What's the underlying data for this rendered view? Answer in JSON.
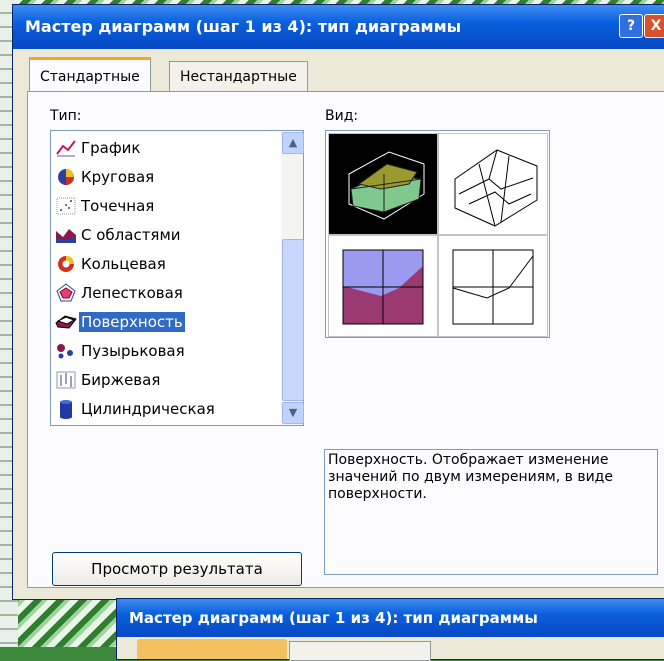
{
  "dialog": {
    "title": "Мастер диаграмм (шаг 1 из 4): тип диаграммы",
    "help_btn": "?",
    "close_btn": "X"
  },
  "tabs": [
    {
      "label": "Стандартные",
      "active": true
    },
    {
      "label": "Нестандартные",
      "active": false
    }
  ],
  "type_label": "Тип:",
  "view_label": "Вид:",
  "types": [
    {
      "label": "График",
      "icon": "line-chart-icon",
      "selected": false
    },
    {
      "label": "Круговая",
      "icon": "pie-chart-icon",
      "selected": false
    },
    {
      "label": "Точечная",
      "icon": "scatter-chart-icon",
      "selected": false
    },
    {
      "label": "С областями",
      "icon": "area-chart-icon",
      "selected": false
    },
    {
      "label": "Кольцевая",
      "icon": "doughnut-chart-icon",
      "selected": false
    },
    {
      "label": "Лепестковая",
      "icon": "radar-chart-icon",
      "selected": false
    },
    {
      "label": "Поверхность",
      "icon": "surface-chart-icon",
      "selected": true
    },
    {
      "label": "Пузырьковая",
      "icon": "bubble-chart-icon",
      "selected": false
    },
    {
      "label": "Биржевая",
      "icon": "stock-chart-icon",
      "selected": false
    },
    {
      "label": "Цилиндрическая",
      "icon": "cylinder-chart-icon",
      "selected": false
    }
  ],
  "description": "Поверхность. Отображает изменение значений по двум измерениям, в виде поверхности.",
  "preview_button": "Просмотр результата",
  "second_dialog": {
    "title": "Мастер диаграмм (шаг 1 из 4): тип диаграммы"
  },
  "colors": {
    "titlebar": "#0a5fdc",
    "selection": "#316ac5",
    "active_tab_accent": "#f5a623",
    "surface_green": "#7fc98f",
    "surface_olive": "#9a9a2e",
    "surface_purple": "#9b3a72",
    "surface_blue": "#9a9af0"
  }
}
